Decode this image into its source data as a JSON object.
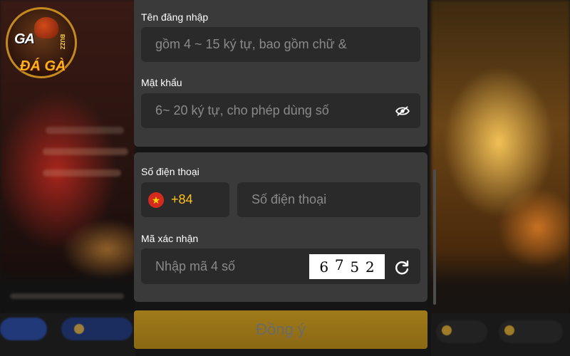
{
  "logo": {
    "top_text": "GA",
    "side_text": "BUZZ",
    "bottom_text": "ĐÁ GÀ"
  },
  "form": {
    "username": {
      "label": "Tên đăng nhập",
      "placeholder": "gồm 4 ~ 15 ký tự, bao gồm chữ &"
    },
    "password": {
      "label": "Mật khẩu",
      "placeholder": "6~ 20 ký tự, cho phép dùng số"
    },
    "phone": {
      "label": "Số điện thoại",
      "country_code": "+84",
      "flag_glyph": "★",
      "placeholder": "Số điện thoại"
    },
    "captcha": {
      "label": "Mã xác nhận",
      "placeholder": "Nhập mã 4 số",
      "digits": [
        "6",
        "7",
        "5",
        "2"
      ]
    },
    "submit_label": "Đồng ý"
  },
  "icons": {
    "password_toggle": "eye-slash-icon",
    "captcha_refresh": "refresh-icon"
  },
  "colors": {
    "card_bg": "#3a3a3a",
    "field_bg": "#2a2a2a",
    "accent": "#ffc21a",
    "submit_bg": "#9a7518",
    "flag_red": "#d52b1e"
  }
}
